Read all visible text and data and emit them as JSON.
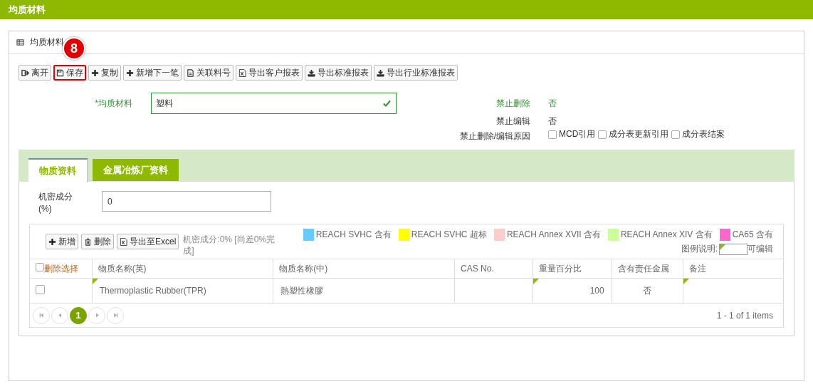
{
  "header": {
    "title": "均质材料"
  },
  "panel": {
    "title": "均质材料"
  },
  "callout": {
    "number": "8"
  },
  "toolbar": [
    {
      "label": "离开",
      "highlighted": false
    },
    {
      "label": "保存",
      "highlighted": true
    },
    {
      "label": "复制",
      "highlighted": false
    },
    {
      "label": "新增下一笔",
      "highlighted": false
    },
    {
      "label": "关联料号",
      "highlighted": false
    },
    {
      "label": "导出客户报表",
      "highlighted": false
    },
    {
      "label": "导出标准报表",
      "highlighted": false
    },
    {
      "label": "导出行业标准报表",
      "highlighted": false
    }
  ],
  "form": {
    "material": {
      "label": "*均质材料",
      "value": "塑料",
      "valid": true
    },
    "no_delete": {
      "label": "禁止删除",
      "value": "否"
    },
    "no_edit": {
      "label": "禁止编辑",
      "value": "否"
    },
    "reason": {
      "label": "禁止删除/编辑原因",
      "options": [
        {
          "label": "MCD引用",
          "checked": false
        },
        {
          "label": "成分表更新引用",
          "checked": false
        },
        {
          "label": "成分表结案",
          "checked": false
        }
      ]
    }
  },
  "tabs": [
    {
      "label": "物质资料",
      "selected": true
    },
    {
      "label": "金属冶炼厂资料",
      "selected": false
    }
  ],
  "confidential": {
    "label": "机密成分 (%)",
    "value": "0"
  },
  "grid_toolbar": [
    {
      "label": "新增"
    },
    {
      "label": "删除"
    },
    {
      "label": "导出至Excel"
    }
  ],
  "summary": "机密成分:0% [尚差0%完成]",
  "legend": [
    {
      "label": "REACH SVHC 含有",
      "color": "#66ccff"
    },
    {
      "label": "REACH SVHC 超标",
      "color": "#ffff00"
    },
    {
      "label": "REACH Annex XVII 含有",
      "color": "#ffcccc"
    },
    {
      "label": "REACH Annex XIV 含有",
      "color": "#ccff99"
    },
    {
      "label": "CA65 含有",
      "color": "#ff66cc"
    }
  ],
  "legend_note": {
    "label": "图例说明:",
    "suffix": "可编辑"
  },
  "table": {
    "select_all": {
      "label": "删除选择",
      "checked": false
    },
    "columns": [
      "物质名称(英)",
      "物质名称(中)",
      "CAS No.",
      "重量百分比",
      "含有责任金属",
      "备注"
    ],
    "rows": [
      {
        "checked": false,
        "cells": [
          {
            "text": "Thermoplastic Rubber(TPR)",
            "editable": true
          },
          {
            "text": "熱塑性橡膠",
            "editable": false
          },
          {
            "editable": false
          },
          {
            "text": "100",
            "editable": true
          },
          {
            "text": "否",
            "editable": false
          },
          {
            "editable": true
          }
        ]
      }
    ]
  },
  "pager": {
    "pages": [
      {
        "label": "1",
        "selected": true
      }
    ],
    "info": "1 - 1 of 1 items"
  }
}
